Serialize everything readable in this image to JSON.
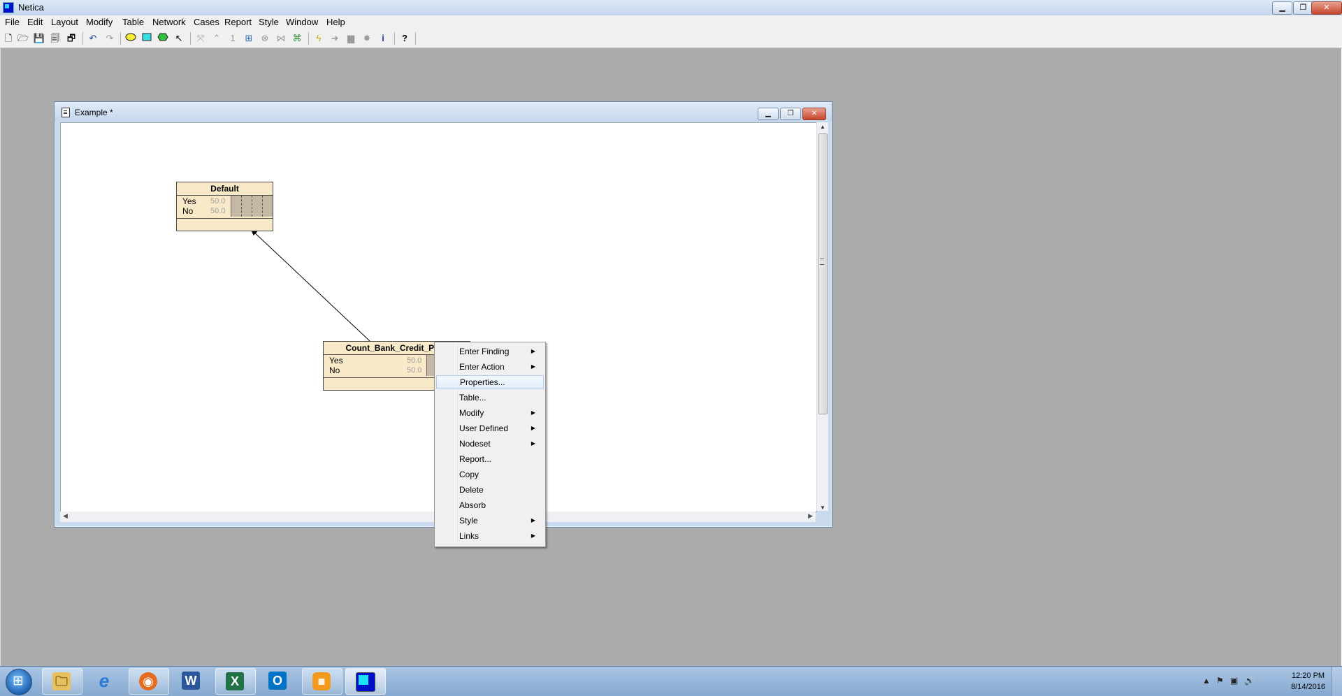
{
  "app": {
    "title": "Netica",
    "caption_buttons": {
      "minimize": "▁",
      "restore": "❐",
      "close": "✕"
    }
  },
  "menubar": [
    "File",
    "Edit",
    "Layout",
    "Modify",
    "Table",
    "Network",
    "Cases",
    "Report",
    "Style",
    "Window",
    "Help"
  ],
  "toolbar": {
    "icons": [
      "new-icon",
      "open-icon",
      "save-icon",
      "save-all-icon",
      "save-copy-icon",
      "undo-icon",
      "redo-icon",
      "nature-node-icon",
      "decision-node-icon",
      "utility-node-icon",
      "select-arrow-icon",
      "add-link-icon",
      "remove-link-icon",
      "one-icon",
      "compile-icon",
      "absorb-icon",
      "optimize-icon",
      "learn-icon",
      "lightning-icon",
      "arrow-right-icon",
      "hammer-icon",
      "star-icon",
      "info-icon",
      "help-icon"
    ]
  },
  "document_window": {
    "title": "Example *",
    "caption_buttons": {
      "minimize": "▁",
      "restore": "❐",
      "close": "✕"
    }
  },
  "nodes": [
    {
      "name": "Default",
      "states": [
        {
          "label": "Yes",
          "value": "50.0"
        },
        {
          "label": "No",
          "value": "50.0"
        }
      ]
    },
    {
      "name": "Count_Bank_Credit_Prod",
      "states": [
        {
          "label": "Yes",
          "value": "50.0"
        },
        {
          "label": "No",
          "value": "50.0"
        }
      ]
    }
  ],
  "context_menu": {
    "items": [
      {
        "label": "Enter Finding",
        "submenu": true
      },
      {
        "label": "Enter Action",
        "submenu": true
      },
      {
        "label": "Properties...",
        "submenu": false,
        "highlighted": true
      },
      {
        "label": "Table...",
        "submenu": false
      },
      {
        "label": "Modify",
        "submenu": true
      },
      {
        "label": "User Defined",
        "submenu": true
      },
      {
        "label": "Nodeset",
        "submenu": true
      },
      {
        "label": "Report...",
        "submenu": false
      },
      {
        "label": "Copy",
        "submenu": false
      },
      {
        "label": "Delete",
        "submenu": false
      },
      {
        "label": "Absorb",
        "submenu": false
      },
      {
        "label": "Style",
        "submenu": true
      },
      {
        "label": "Links",
        "submenu": true
      }
    ],
    "submenu_arrow": "▶"
  },
  "taskbar": {
    "apps": [
      {
        "name": "windows-explorer",
        "glyph": "🗀",
        "color": "#e7c160"
      },
      {
        "name": "internet-explorer",
        "glyph": "e",
        "color": "#2a7bd6"
      },
      {
        "name": "firefox",
        "glyph": "◉",
        "color": "#e46b1f"
      },
      {
        "name": "word",
        "glyph": "W",
        "color": "#2b579a"
      },
      {
        "name": "excel",
        "glyph": "X",
        "color": "#217346"
      },
      {
        "name": "outlook",
        "glyph": "O",
        "color": "#0072c6"
      },
      {
        "name": "app-orange",
        "glyph": "■",
        "color": "#f39a1e"
      },
      {
        "name": "netica",
        "glyph": "",
        "color": "#0010c8"
      }
    ],
    "tray": {
      "time": "12:20 PM",
      "date": "8/14/2016",
      "icons": [
        "show-hidden-icon",
        "flag-icon",
        "network-icon",
        "volume-icon"
      ]
    }
  }
}
